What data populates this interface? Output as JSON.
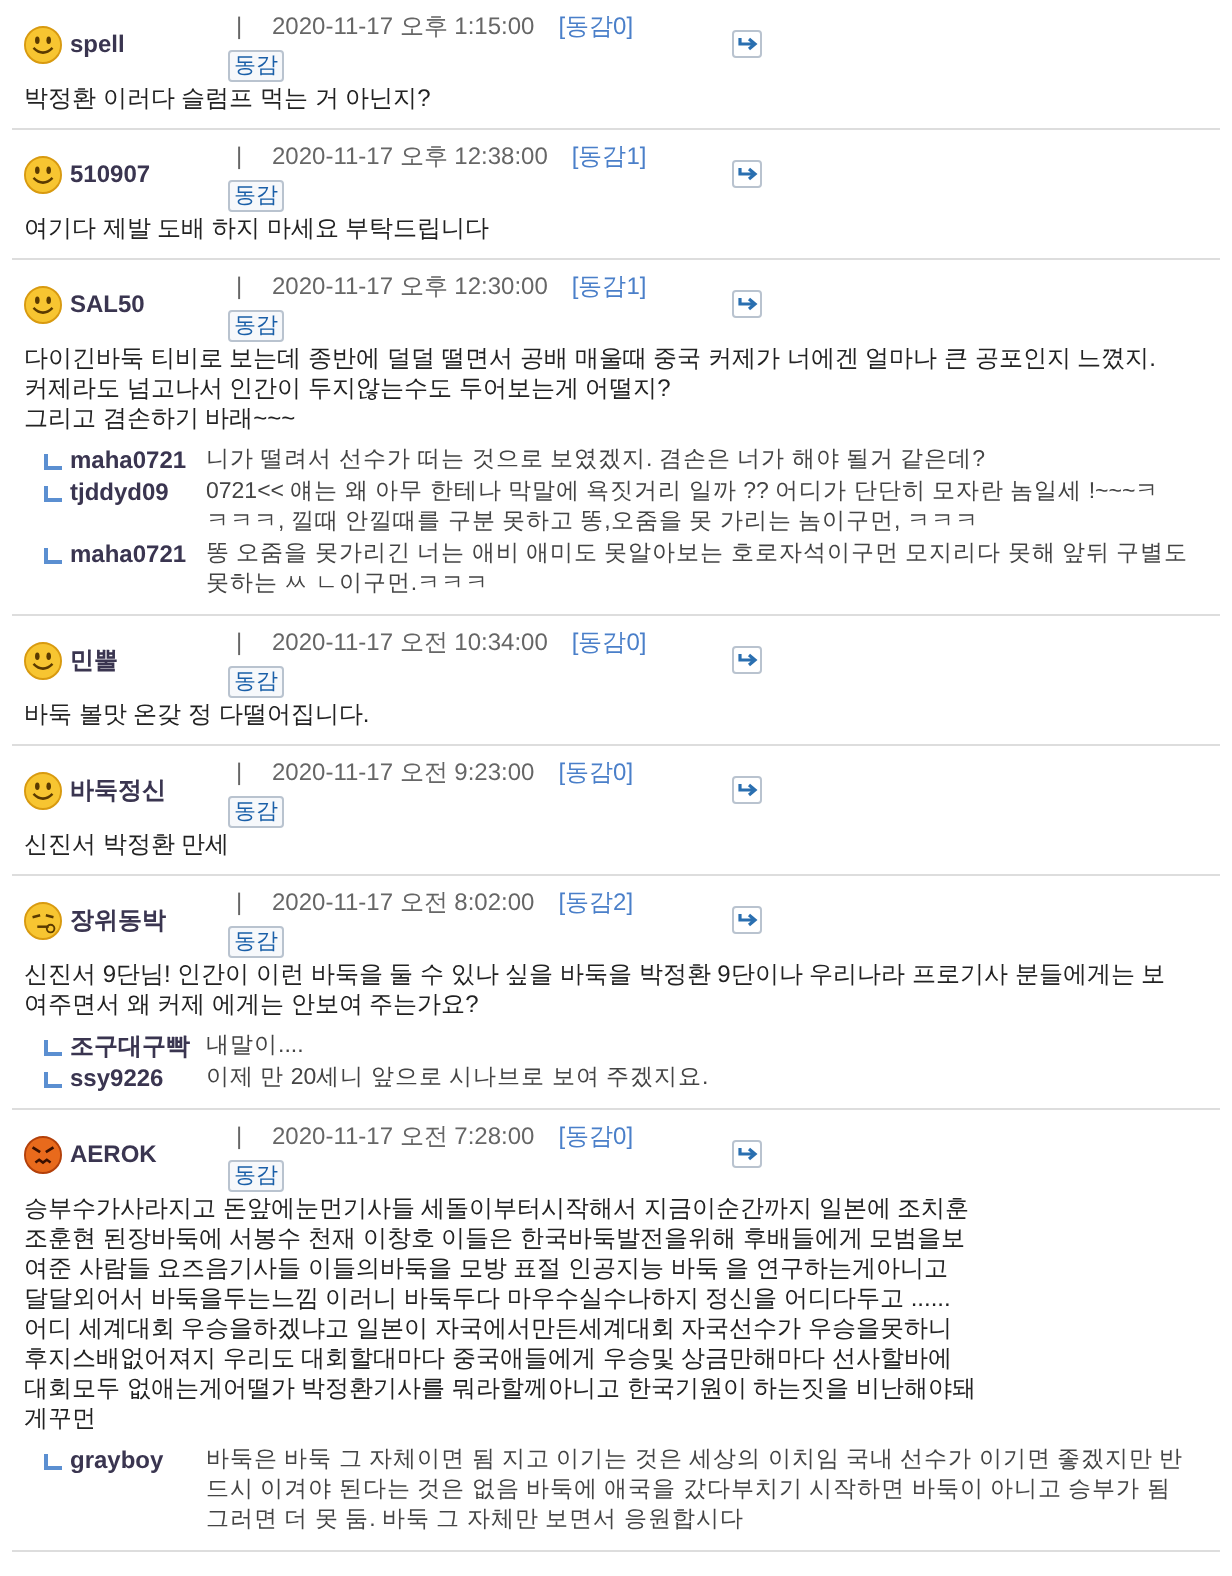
{
  "comments": [
    {
      "kind": "smile",
      "nick": "spell",
      "separator": "|",
      "date": "2020-11-17 오후 1:15:00",
      "agree_count": "[동감0]",
      "agree_button": "동감",
      "body": [
        "박정환 이러다 슬럼프 먹는 거 아닌지?"
      ]
    },
    {
      "kind": "smile",
      "nick": "510907",
      "separator": "|",
      "date": "2020-11-17 오후 12:38:00",
      "agree_count": "[동감1]",
      "agree_button": "동감",
      "body": [
        "여기다 제발 도배 하지 마세요 부탁드립니다"
      ]
    },
    {
      "kind": "smile",
      "nick": "SAL50",
      "separator": "|",
      "date": "2020-11-17 오후 12:30:00",
      "agree_count": "[동감1]",
      "agree_button": "동감",
      "body": [
        "다이긴바둑 티비로 보는데 종반에 덜덜 떨면서 공배 매울때 중국 커제가 너에겐 얼마나 큰 공포인지 느꼈지.",
        "커제라도 넘고나서 인간이 두지않는수도 두어보는게 어떨지?",
        "그리고 겸손하기 바래~~~"
      ],
      "replies": [
        {
          "nick": "maha0721",
          "lines": [
            "니가 떨려서 선수가 떠는 것으로 보였겠지. 겸손은 너가 해야 될거 같은데?"
          ]
        },
        {
          "nick": "tjddyd09",
          "lines": [
            "0721<< 얘는 왜 아무 한테나 막말에 욕짓거리 일까 ?? 어디가 단단히 모자란 놈일세 !~~~ㅋ",
            "ㅋㅋㅋ, 낄때 안낄때를 구분 못하고 똥,오줌을 못 가리는 놈이구먼, ㅋㅋㅋ"
          ]
        },
        {
          "nick": "maha0721",
          "lines": [
            "똥 오줌을 못가리긴 너는 애비 애미도 못알아보는 호로자석이구먼 모지리다 못해 앞뒤 구별도",
            "못하는 ㅆ ㄴ이구먼.ㅋㅋㅋ"
          ]
        }
      ]
    },
    {
      "kind": "smile",
      "nick": "민뿔",
      "separator": "|",
      "date": "2020-11-17 오전 10:34:00",
      "agree_count": "[동감0]",
      "agree_button": "동감",
      "body": [
        "바둑 볼맛 온갖 정 다떨어집니다."
      ]
    },
    {
      "kind": "smile",
      "nick": "바둑정신",
      "separator": "|",
      "date": "2020-11-17 오전 9:23:00",
      "agree_count": "[동감0]",
      "agree_button": "동감",
      "body": [
        "신진서 박정환 만세"
      ]
    },
    {
      "kind": "sleepy",
      "nick": "장위동박",
      "separator": "|",
      "date": "2020-11-17 오전 8:02:00",
      "agree_count": "[동감2]",
      "agree_button": "동감",
      "body": [
        "신진서 9단님! 인간이 이런 바둑을 둘 수 있나 싶을 바둑을 박정환 9단이나 우리나라 프로기사 분들에게는 보",
        "여주면서 왜 커제 에게는 안보여 주는가요?"
      ],
      "replies": [
        {
          "nick": "조구대구빡",
          "lines": [
            "내말이...."
          ]
        },
        {
          "nick": "ssy9226",
          "lines": [
            "이제 만 20세니 앞으로 시나브로 보여 주겠지요."
          ]
        }
      ]
    },
    {
      "kind": "angry",
      "nick": "AEROK",
      "separator": "|",
      "date": "2020-11-17 오전 7:28:00",
      "agree_count": "[동감0]",
      "agree_button": "동감",
      "body": [
        "승부수가사라지고 돈앞에눈먼기사들 세돌이부터시작해서 지금이순간까지 일본에 조치훈",
        "조훈현 된장바둑에 서봉수 천재 이창호 이들은 한국바둑발전을위해 후배들에게 모범을보",
        "여준 사람들 요즈음기사들 이들의바둑을 모방 표절 인공지능 바둑 을 연구하는게아니고",
        "달달외어서 바둑을두는느낌 이러니 바둑두다 마우수실수나하지 정신을 어디다두고 ......",
        "어디 세계대회 우승을하겠냐고 일본이 자국에서만든세계대회 자국선수가 우승을못하니",
        "후지스배없어져지 우리도 대회할대마다 중국애들에게 우승및 상금만해마다 선사할바에",
        "대회모두 없애는게어떨가 박정환기사를 뭐라할께아니고 한국기원이 하는짓을 비난해야돼",
        "게꾸먼"
      ],
      "replies": [
        {
          "nick": "grayboy",
          "lines": [
            "바둑은 바둑 그 자체이면 됨 지고 이기는 것은 세상의 이치임 국내 선수가 이기면 좋겠지만 반",
            "드시 이겨야 된다는 것은 없음 바둑에 애국을 갔다부치기 시작하면 바둑이 아니고 승부가 됨",
            "그러면 더 못 둠. 바둑 그 자체만 보면서 응원합시다"
          ]
        }
      ]
    }
  ]
}
